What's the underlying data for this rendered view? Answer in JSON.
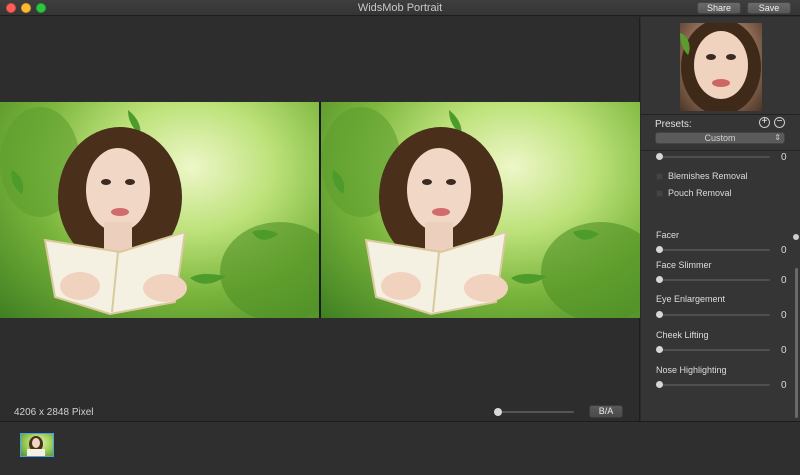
{
  "window": {
    "title": "WidsMob Portrait",
    "share_label": "Share",
    "save_label": "Save"
  },
  "canvas": {
    "image_size": "4206 x 2848 Pixel",
    "compare_label": "B/A"
  },
  "panel": {
    "presets_label": "Presets:",
    "preset_selected": "Custom",
    "top_slider_value": "0",
    "checkboxes": [
      {
        "label": "Blemishes Removal",
        "checked": false
      },
      {
        "label": "Pouch Removal",
        "checked": false
      }
    ],
    "sliders": [
      {
        "label": "Facer",
        "value": "0"
      },
      {
        "label": "Face Slimmer",
        "value": "0"
      },
      {
        "label": "Eye Enlargement",
        "value": "0"
      },
      {
        "label": "Cheek Lifting",
        "value": "0"
      },
      {
        "label": "Nose Highlighting",
        "value": "0"
      }
    ]
  },
  "icons": {
    "add": "plus-circle-icon",
    "remove": "minus-circle-icon",
    "dropdown": "updown-chevron-icon"
  }
}
